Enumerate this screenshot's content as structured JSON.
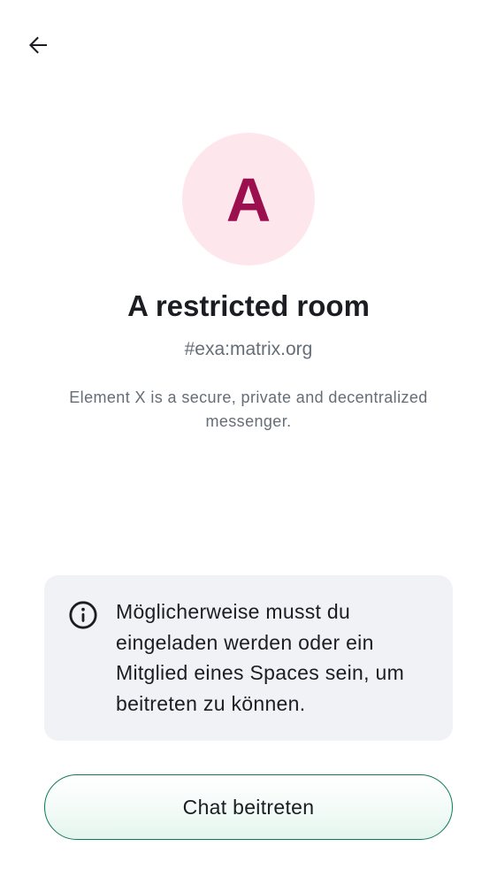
{
  "header": {
    "back_icon": "arrow-left-icon"
  },
  "room": {
    "avatar_letter": "A",
    "avatar_bg_color": "#fde7ec",
    "avatar_text_color": "#9b0f4e",
    "name": "A restricted room",
    "alias": "#exa:matrix.org",
    "description": "Element X is a secure, private and decentralized messenger."
  },
  "notice": {
    "icon": "info-icon",
    "text": "Möglicherweise musst du eingeladen werden oder ein Mitglied eines Spaces sein, um beitreten zu können."
  },
  "actions": {
    "join_label": "Chat beitreten",
    "accent_color": "#0d7b5a"
  }
}
